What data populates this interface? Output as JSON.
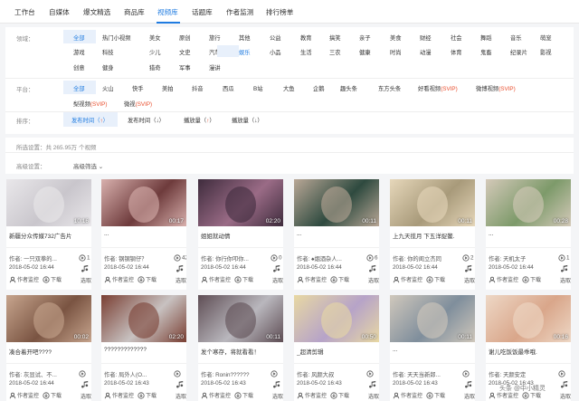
{
  "nav": {
    "items": [
      "工作台",
      "自媒体",
      "爆文精选",
      "商品库",
      "视频库",
      "话题库",
      "作者监测",
      "排行榜单"
    ],
    "active": 4
  },
  "filter": {
    "domain_label": "领域：",
    "domain_tags": [
      [
        "全部",
        "热门小视频",
        "美女",
        "原创",
        "旅行",
        "其他",
        "公益",
        "教育",
        "搞笑",
        "亲子",
        "美食",
        "财经",
        "社会",
        "舞蹈",
        "音乐",
        "萌宠"
      ],
      [
        "游戏",
        "科技",
        "少儿",
        "文史",
        "汽车",
        "娱乐",
        "小品",
        "生活",
        "三农",
        "健康",
        "时尚",
        "动漫",
        "体育",
        "鬼畜",
        "纪录片",
        "影视"
      ],
      [
        "创意",
        "健身",
        "猎奇",
        "军事",
        "漫讲"
      ]
    ],
    "platform_label": "平台：",
    "platform_tags": [
      [
        "全部",
        "火山",
        "快手",
        "美拍",
        "抖音",
        "西瓜",
        "B站",
        "大鱼",
        "企鹅",
        "趣头条",
        "东方头条",
        "好看视频",
        "微博视频"
      ],
      [
        "梨视频",
        "微视"
      ]
    ],
    "vip_mark": "(SVIP)",
    "sort_label": "排序：",
    "sort_options": [
      "发布时间（↑）",
      "发布时间（↓）",
      "播放量（↑）",
      "播放量（↓）"
    ],
    "up_arrow": "↑",
    "down_arrow": "↓"
  },
  "info": {
    "count_text": "所选设置：共 265.95万 个视频",
    "adv_label": "高级设置：",
    "adv_value": "高级筛选 ⌄"
  },
  "cards": [
    {
      "title": "新疆分众传媒732广告片",
      "duration": "10:16",
      "author": "作者: 一只双拳的...",
      "date": "2018-05-02 16:44",
      "count": "1",
      "thumb": "#c9c6cc",
      "thumb2": "#e9e7ea"
    },
    {
      "title": "...",
      "duration": "00:17",
      "author": "作者: 钢钢钢仔？",
      "date": "2018-05-02 16:44",
      "count": "42",
      "thumb": "#6e3b3c",
      "thumb2": "#d8b0ad"
    },
    {
      "title": "\\u0026#20;姐姐就动情\\u0026#20;",
      "duration": "02:20",
      "author": "作者: 你行你叩你...",
      "date": "2018-05-02 16:44",
      "count": "0",
      "thumb": "#9a6b86",
      "thumb2": "#3f2c3d"
    },
    {
      "title": "...",
      "duration": "00:11",
      "author": "作者: ♠烟酒杂人...",
      "date": "2018-05-02 16:44",
      "count": "6",
      "thumb": "#2e4a3f",
      "thumb2": "#b9a796"
    },
    {
      "title": "上九天揽月 下五洋捉鳖.",
      "duration": "00:11",
      "author": "作者: 你的闺立杰同",
      "date": "2018-05-02 16:44",
      "count": "2",
      "thumb": "#a89a7a",
      "thumb2": "#e6d7ba"
    },
    {
      "title": "...",
      "duration": "00:28",
      "author": "作者: 天机太子",
      "date": "2018-05-02 16:44",
      "count": "1",
      "thumb": "#7d9a6a",
      "thumb2": "#d4c9b9"
    },
    {
      "title": "凑合着开吧????",
      "duration": "00:02",
      "author": "作者: 灰显试、不...",
      "date": "2018-05-02 16:44",
      "count": "",
      "thumb": "#7a5442",
      "thumb2": "#c7a58e"
    },
    {
      "title": "?????????????",
      "duration": "02:20",
      "author": "作者: 局外人(O...",
      "date": "2018-05-02 16:43",
      "count": "",
      "thumb": "#c8c2c1",
      "thumb2": "#7a3f33"
    },
    {
      "title": "发个寒存，将就看看！",
      "duration": "00:11",
      "author": "作者: Ronin??????",
      "date": "2018-05-02 16:43",
      "count": "",
      "thumb": "#b9b7bd",
      "thumb2": "#5f4e55"
    },
    {
      "title": "_超清剪辑",
      "duration": "00:50",
      "author": "作者: 风颜大叔",
      "date": "2018-05-02 16:43",
      "count": "",
      "thumb": "#b6a3c8",
      "thumb2": "#e8d8a3"
    },
    {
      "title": "...",
      "duration": "00:11",
      "author": "作者: 天天当新郎...",
      "date": "2018-05-02 16:43",
      "count": "",
      "thumb": "#7f8e9c",
      "thumb2": "#d0c8bc"
    },
    {
      "title": "谢儿吃饭饭最乖哦.",
      "duration": "00:16",
      "author": "作者: 天颜安定",
      "date": "2018-05-02 16:43",
      "count": "",
      "thumb": "#d9a68a",
      "thumb2": "#eed8c6"
    }
  ],
  "card_labels": {
    "monitor": "作者监控",
    "download": "下载",
    "select": "选取"
  },
  "watermark": "头条 @中小精灵"
}
